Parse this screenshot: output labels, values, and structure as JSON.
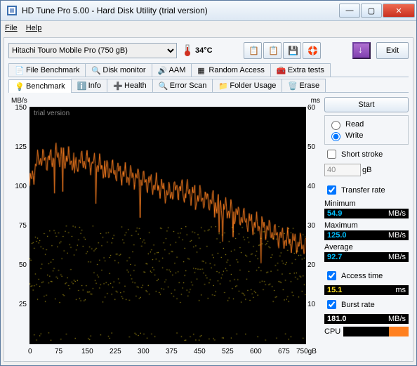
{
  "window": {
    "title": "HD Tune Pro 5.00 - Hard Disk Utility (trial version)"
  },
  "menu": {
    "file": "File",
    "help": "Help"
  },
  "toolbar": {
    "drive": "Hitachi Touro Mobile Pro (750 gB)",
    "temp": "34°C",
    "exit": "Exit"
  },
  "tabs_row2": [
    {
      "label": "File Benchmark"
    },
    {
      "label": "Disk monitor"
    },
    {
      "label": "AAM"
    },
    {
      "label": "Random Access"
    },
    {
      "label": "Extra tests"
    }
  ],
  "tabs_row1": [
    {
      "label": "Benchmark",
      "active": true
    },
    {
      "label": "Info"
    },
    {
      "label": "Health"
    },
    {
      "label": "Error Scan"
    },
    {
      "label": "Folder Usage"
    },
    {
      "label": "Erase"
    }
  ],
  "side": {
    "start": "Start",
    "read": "Read",
    "write": "Write",
    "short_stroke": "Short stroke",
    "stroke_val": "40",
    "stroke_unit": "gB",
    "transfer_rate": "Transfer rate",
    "min_label": "Minimum",
    "min": "54.9",
    "max_label": "Maximum",
    "max": "125.0",
    "avg_label": "Average",
    "avg": "92.7",
    "unit": "MB/s",
    "access_label": "Access time",
    "access": "15.1",
    "access_unit": "ms",
    "burst_label": "Burst rate",
    "burst": "181.0",
    "cpu_label": "CPU"
  },
  "chart": {
    "y_left_unit": "MB/s",
    "y_right_unit": "ms",
    "x_unit": "gB",
    "watermark": "trial version"
  },
  "chart_data": {
    "type": "line",
    "xlim": [
      0,
      750
    ],
    "ylim_left": [
      0,
      150
    ],
    "ylim_right": [
      0,
      60
    ],
    "x_ticks": [
      0,
      75,
      150,
      225,
      300,
      375,
      450,
      525,
      600,
      675,
      "750gB"
    ],
    "y_ticks_left": [
      25,
      50,
      75,
      100,
      125,
      150
    ],
    "y_ticks_right": [
      10,
      20,
      30,
      40,
      50,
      60
    ],
    "series": [
      {
        "name": "transfer_rate",
        "color": "#ff8020",
        "x": [
          0,
          25,
          50,
          75,
          100,
          125,
          150,
          175,
          200,
          225,
          250,
          275,
          300,
          325,
          350,
          375,
          400,
          425,
          450,
          475,
          500,
          525,
          550,
          575,
          600,
          625,
          650,
          675,
          700,
          725,
          750
        ],
        "y": [
          100,
          118,
          116,
          120,
          118,
          115,
          116,
          114,
          112,
          110,
          108,
          106,
          104,
          102,
          100,
          95,
          98,
          97,
          94,
          92,
          90,
          86,
          84,
          80,
          77,
          75,
          72,
          68,
          66,
          64,
          62
        ]
      },
      {
        "name": "access_time_upper",
        "type": "scatter",
        "color": "#ffe020",
        "y_axis": "right",
        "approx_mean": 25,
        "approx_spread": 5
      },
      {
        "name": "access_time_lower",
        "type": "scatter",
        "color": "#ffe020",
        "y_axis": "right",
        "approx_mean": 15,
        "approx_spread": 5
      }
    ]
  }
}
